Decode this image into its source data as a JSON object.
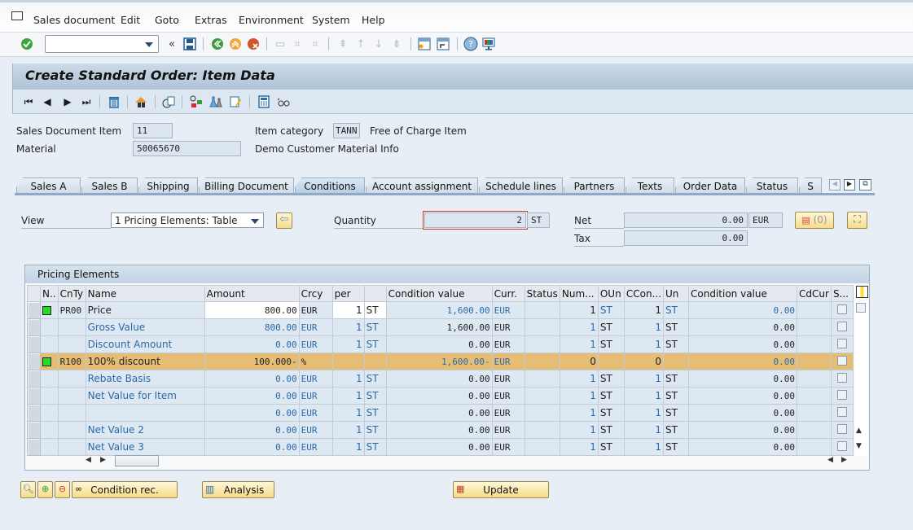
{
  "menubar": {
    "items": [
      "Sales document",
      "Edit",
      "Goto",
      "Extras",
      "Environment",
      "System",
      "Help"
    ]
  },
  "toolbar": {
    "command_field_value": "",
    "icons": [
      "enter-icon",
      "command-dropdown",
      "collapse-icon",
      "save-icon",
      "back-icon",
      "exit-icon",
      "cancel-icon",
      "print-icon",
      "find-icon",
      "find-next-icon",
      "first-page-icon",
      "previous-page-icon",
      "next-page-icon",
      "last-page-icon",
      "create-session-icon",
      "shortcut-icon",
      "help-icon",
      "customize-layout-icon"
    ]
  },
  "title": "Create Standard Order: Item Data",
  "header": {
    "sales_doc_item_label": "Sales Document Item",
    "sales_doc_item_value": "11",
    "material_label": "Material",
    "material_value": "50065670",
    "item_category_label": "Item category",
    "item_category_value": "TANN",
    "item_category_desc": "Free of Charge Item",
    "material_desc": "Demo Customer Material Info"
  },
  "tabs": [
    "Sales A",
    "Sales B",
    "Shipping",
    "Billing Document",
    "Conditions",
    "Account assignment",
    "Schedule lines",
    "Partners",
    "Texts",
    "Order Data",
    "Status",
    "S"
  ],
  "active_tab": "Conditions",
  "conditions": {
    "view_label": "View",
    "view_value": "1 Pricing Elements: Table",
    "quantity_label": "Quantity",
    "quantity_value": "2",
    "quantity_unit": "ST",
    "net_label": "Net",
    "net_value": "0.00",
    "net_currency": "EUR",
    "tax_label": "Tax",
    "tax_value": "0.00",
    "messages_label": "(0)"
  },
  "table": {
    "caption": "Pricing Elements",
    "columns": [
      "N..",
      "CnTy",
      "Name",
      "Amount",
      "Crcy",
      "per",
      "",
      "Condition value",
      "Curr.",
      "Status",
      "Num...",
      "OUn",
      "CCon...",
      "Un",
      "Condition value",
      "CdCur",
      "S..."
    ],
    "rows": [
      {
        "led": true,
        "cnty": "PR00",
        "name": "Price",
        "amount": "800.00",
        "crcy": "EUR",
        "per": "1",
        "uom": "ST",
        "cond_value": "1,600.00",
        "curr": "EUR",
        "status": "",
        "num": "1",
        "oun": "ST",
        "ccon": "1",
        "un": "ST",
        "cond_value2": "0.00",
        "cdcur": ""
      },
      {
        "led": false,
        "cnty": "",
        "name": "Gross Value",
        "amount": "800.00",
        "crcy": "EUR",
        "per": "1",
        "uom": "ST",
        "cond_value": "1,600.00",
        "curr": "EUR",
        "status": "",
        "num": "1",
        "oun": "ST",
        "ccon": "1",
        "un": "ST",
        "cond_value2": "0.00",
        "cdcur": ""
      },
      {
        "led": false,
        "cnty": "",
        "name": "Discount Amount",
        "amount": "0.00",
        "crcy": "EUR",
        "per": "1",
        "uom": "ST",
        "cond_value": "0.00",
        "curr": "EUR",
        "status": "",
        "num": "1",
        "oun": "ST",
        "ccon": "1",
        "un": "ST",
        "cond_value2": "0.00",
        "cdcur": ""
      },
      {
        "led": true,
        "cnty": "R100",
        "name": "100% discount",
        "amount": "100.000-",
        "crcy": "%",
        "per": "",
        "uom": "",
        "cond_value": "1,600.00-",
        "curr": "EUR",
        "status": "",
        "num": "0",
        "oun": "",
        "ccon": "0",
        "un": "",
        "cond_value2": "0.00",
        "cdcur": ""
      },
      {
        "led": false,
        "cnty": "",
        "name": "Rebate Basis",
        "amount": "0.00",
        "crcy": "EUR",
        "per": "1",
        "uom": "ST",
        "cond_value": "0.00",
        "curr": "EUR",
        "status": "",
        "num": "1",
        "oun": "ST",
        "ccon": "1",
        "un": "ST",
        "cond_value2": "0.00",
        "cdcur": ""
      },
      {
        "led": false,
        "cnty": "",
        "name": "Net Value for Item",
        "amount": "0.00",
        "crcy": "EUR",
        "per": "1",
        "uom": "ST",
        "cond_value": "0.00",
        "curr": "EUR",
        "status": "",
        "num": "1",
        "oun": "ST",
        "ccon": "1",
        "un": "ST",
        "cond_value2": "0.00",
        "cdcur": ""
      },
      {
        "led": false,
        "cnty": "",
        "name": "",
        "amount": "0.00",
        "crcy": "EUR",
        "per": "1",
        "uom": "ST",
        "cond_value": "0.00",
        "curr": "EUR",
        "status": "",
        "num": "1",
        "oun": "ST",
        "ccon": "1",
        "un": "ST",
        "cond_value2": "0.00",
        "cdcur": ""
      },
      {
        "led": false,
        "cnty": "",
        "name": "Net Value 2",
        "amount": "0.00",
        "crcy": "EUR",
        "per": "1",
        "uom": "ST",
        "cond_value": "0.00",
        "curr": "EUR",
        "status": "",
        "num": "1",
        "oun": "ST",
        "ccon": "1",
        "un": "ST",
        "cond_value2": "0.00",
        "cdcur": ""
      },
      {
        "led": false,
        "cnty": "",
        "name": "Net Value 3",
        "amount": "0.00",
        "crcy": "EUR",
        "per": "1",
        "uom": "ST",
        "cond_value": "0.00",
        "curr": "EUR",
        "status": "",
        "num": "1",
        "oun": "ST",
        "ccon": "1",
        "un": "ST",
        "cond_value2": "0.00",
        "cdcur": ""
      }
    ],
    "highlight_row_index": 3
  },
  "buttons": {
    "condition_rec": "Condition rec.",
    "analysis": "Analysis",
    "update": "Update"
  },
  "colors": {
    "highlight_row": "#e5bd74",
    "led_green": "#22dd22",
    "link_blue": "#2a6aa8",
    "title_bar": "#b9cbdd"
  }
}
